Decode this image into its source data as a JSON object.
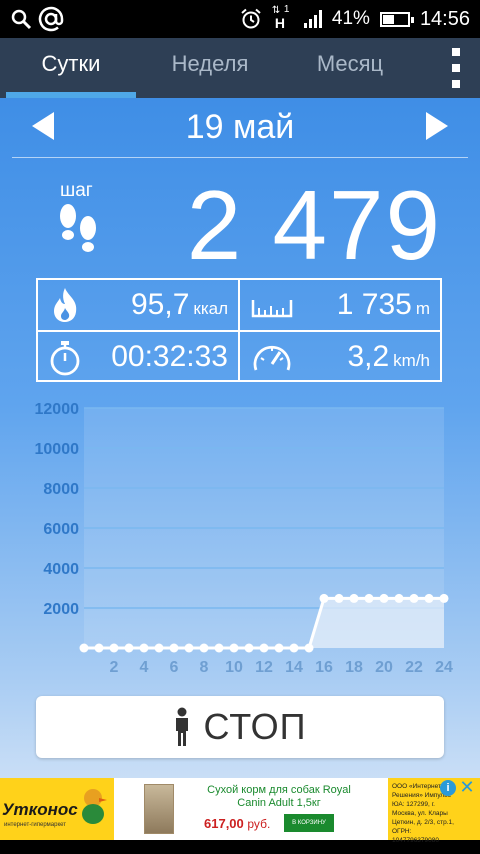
{
  "status_bar": {
    "network_indicator": "1",
    "network_type": "H",
    "battery_percent": "41%",
    "battery_level": 0.41,
    "time": "14:56",
    "icons": [
      "search-icon",
      "at-icon",
      "alarm-icon",
      "data-transfer-icon",
      "signal-icon",
      "battery-icon"
    ]
  },
  "tabs": [
    {
      "label": "Сутки",
      "active": true
    },
    {
      "label": "Неделя",
      "active": false
    },
    {
      "label": "Месяц",
      "active": false
    }
  ],
  "date": "19 май",
  "steps": {
    "label": "шаг",
    "value": "2 479"
  },
  "stats": {
    "calories": {
      "value": "95,7",
      "unit": "ккал",
      "icon": "flame-icon"
    },
    "distance": {
      "value": "1 735",
      "unit": "m",
      "icon": "ruler-icon"
    },
    "duration": {
      "value": "00:32:33",
      "icon": "stopwatch-icon"
    },
    "speed": {
      "value": "3,2",
      "unit": "km/h",
      "icon": "speedometer-icon"
    }
  },
  "chart_data": {
    "type": "line",
    "title": "",
    "xlabel": "",
    "ylabel": "",
    "x_ticks": [
      "2",
      "4",
      "6",
      "8",
      "10",
      "12",
      "14",
      "16",
      "18",
      "20",
      "22",
      "24"
    ],
    "y_ticks": [
      "2000",
      "4000",
      "6000",
      "8000",
      "10000",
      "12000"
    ],
    "ylim": [
      0,
      12000
    ],
    "xlim": [
      0,
      24
    ],
    "grid": true,
    "series": [
      {
        "x": [
          0,
          1,
          2,
          3,
          4,
          5,
          6,
          7,
          8,
          9,
          10,
          11,
          12,
          13,
          14,
          15,
          16,
          17,
          18,
          19,
          20,
          21,
          22,
          23,
          24
        ],
        "values": [
          0,
          0,
          0,
          0,
          0,
          0,
          0,
          0,
          0,
          0,
          0,
          0,
          0,
          0,
          0,
          0,
          2479,
          2479,
          2479,
          2479,
          2479,
          2479,
          2479,
          2479,
          2479
        ]
      }
    ],
    "colors": {
      "line": "#ffffff",
      "grid": "#7ab8f0",
      "area": "#e4eefa"
    }
  },
  "stop_button": {
    "label": "СТОП",
    "icon": "person-icon"
  },
  "ad": {
    "brand": "Утконос",
    "brand_sub": "интернет-гипермаркет",
    "title": "Сухой корм для собак Royal Canin Adult 1,5кг",
    "price": "617,00",
    "currency": "руб.",
    "cart_label": "В КОРЗИНУ",
    "legal": "ООО «Интернет Решения» Импульс ЮА: 127299, г. Москва, ул. Клары Цеткин, д. 2/3, стр.1, ОГРН: 1047796379080",
    "info_icon": "info-icon",
    "close_icon": "close-icon"
  }
}
